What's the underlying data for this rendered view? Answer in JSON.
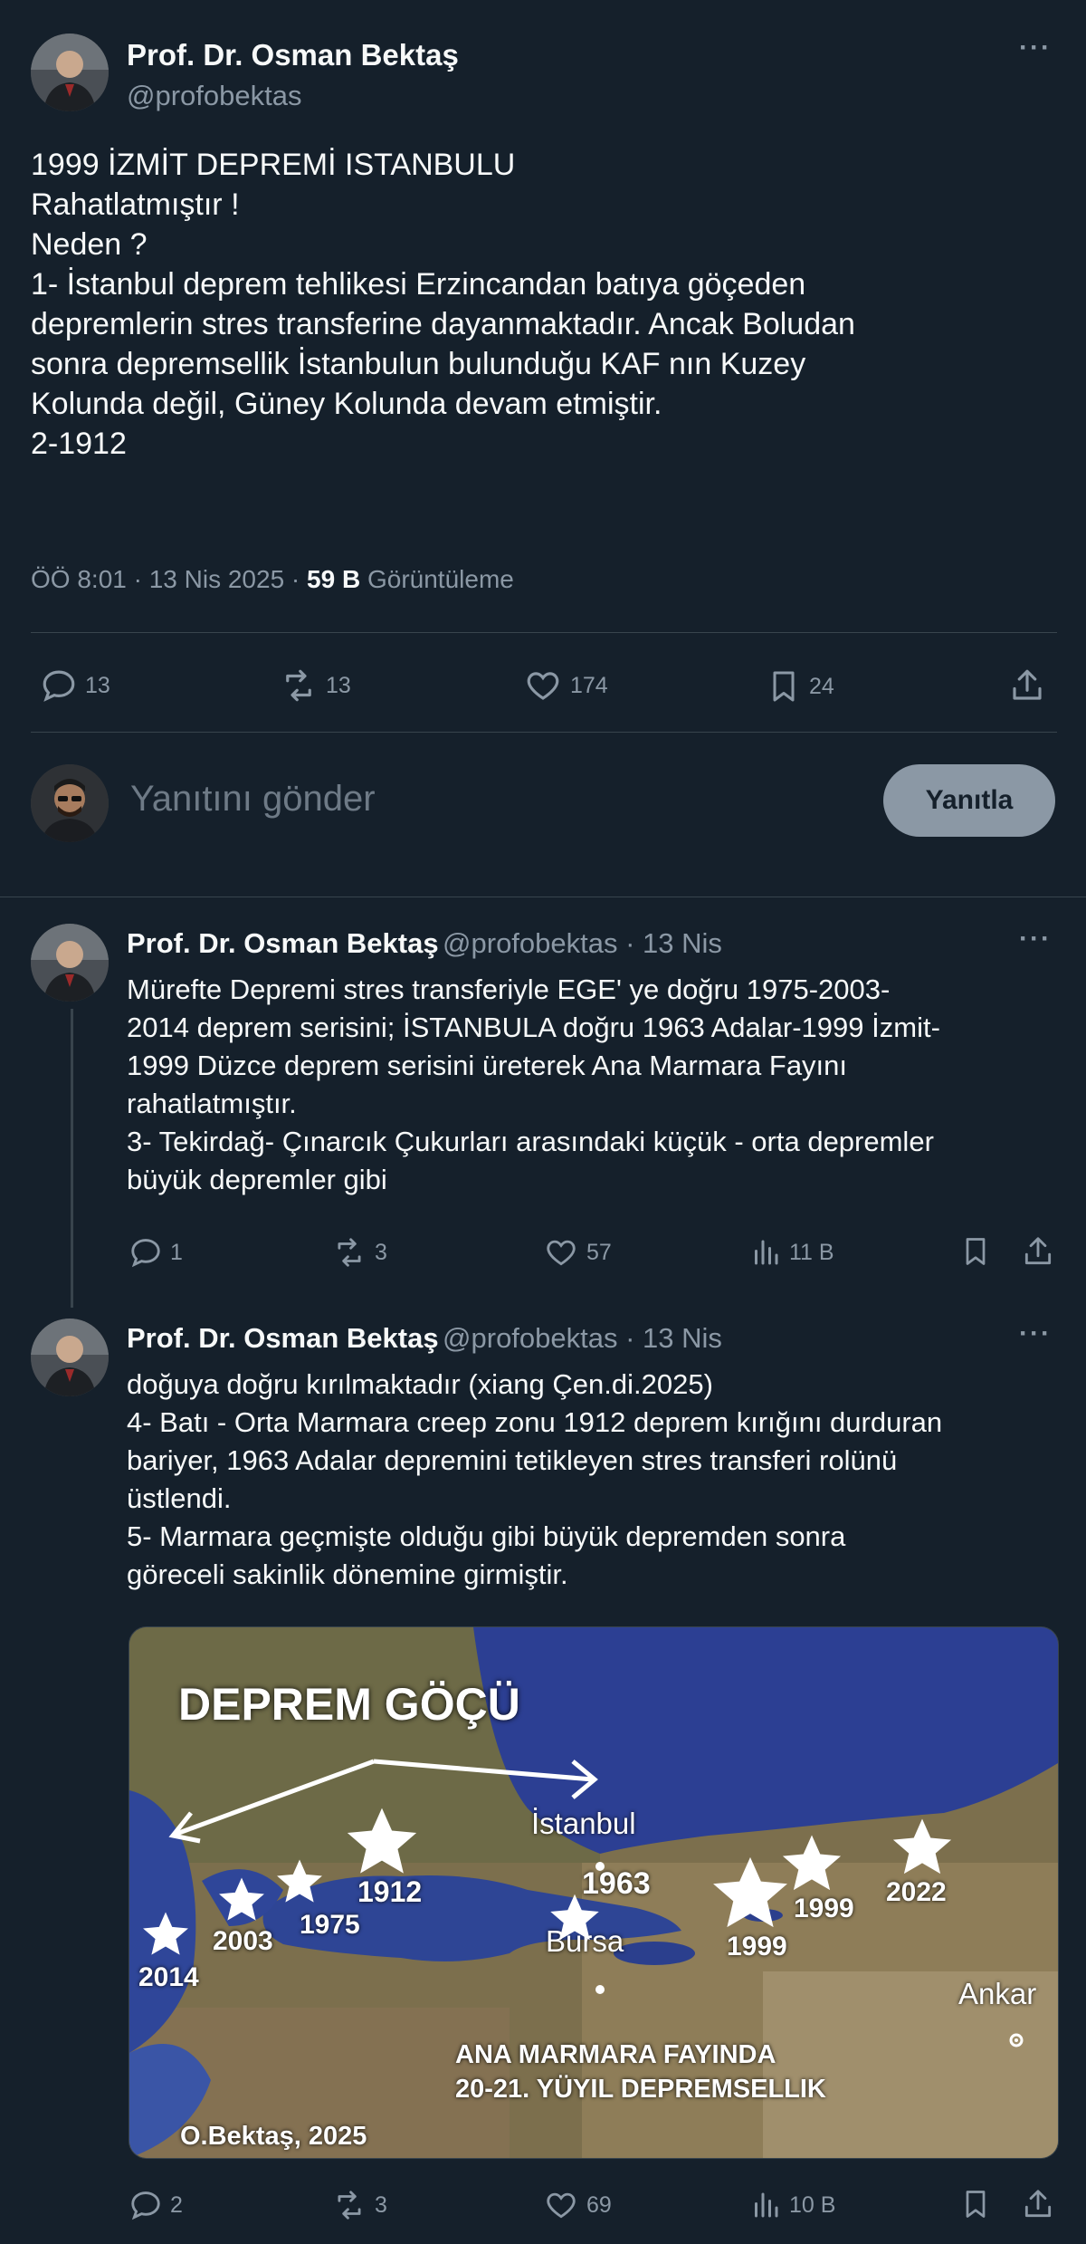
{
  "main_tweet": {
    "author_name": "Prof. Dr. Osman Bektaş",
    "author_handle": "@profobektas",
    "lines": [
      "1999 İZMİT DEPREMİ ISTANBULU",
      "Rahatlatmıştır !",
      "Neden ?",
      "1- İstanbul deprem tehlikesi Erzincandan batıya göçeden",
      "depremlerin stres transferine dayanmaktadır. Ancak Boludan",
      "sonra depremsellik İstanbulun bulunduğu  KAF nın Kuzey",
      "Kolunda değil, Güney Kolunda devam etmiştir.",
      "2-1912"
    ],
    "meta_time": "ÖÖ 8:01 · 13 Nis 2025 · ",
    "views_count": "59 B",
    "views_label": "Görüntüleme",
    "replies": "13",
    "retweets": "13",
    "likes": "174",
    "bookmarks": "24"
  },
  "reply_box": {
    "placeholder": "Yanıtını gönder",
    "button_label": "Yanıtla"
  },
  "reply1": {
    "author_name": "Prof. Dr. Osman Bektaş",
    "handle_time": "@profobektas · 13 Nis",
    "lines": [
      "Mürefte Depremi stres transferiyle EGE' ye doğru 1975-2003-",
      "2014 deprem serisini; İSTANBULA doğru 1963 Adalar-1999 İzmit-",
      "1999 Düzce deprem serisini üreterek Ana Marmara Fayını",
      "rahatlatmıştır.",
      "3- Tekirdağ- Çınarcık Çukurları arasındaki küçük - orta depremler",
      "büyük depremler gibi"
    ],
    "replies": "1",
    "retweets": "3",
    "likes": "57",
    "views": "11 B"
  },
  "reply2": {
    "author_name": "Prof. Dr. Osman Bektaş",
    "handle_time": "@profobektas · 13 Nis",
    "lines": [
      "doğuya doğru kırılmaktadır (xiang Çen.di.2025)",
      "4- Batı - Orta Marmara creep zonu 1912 deprem kırığını durduran",
      "bariyer, 1963 Adalar depremini tetikleyen stres transferi rolünü",
      "üstlendi.",
      "5- Marmara geçmişte olduğu gibi büyük depremden sonra",
      "göreceli sakinlik dönemine girmiştir."
    ],
    "replies": "2",
    "retweets": "3",
    "likes": "69",
    "views": "10 B",
    "image": {
      "title": "DEPREM GÖÇÜ",
      "city_istanbul": "İstanbul",
      "city_bursa": "Bursa",
      "city_ankara": "Ankar",
      "years": [
        "1912",
        "1963",
        "1975",
        "2003",
        "2014",
        "1999",
        "1999",
        "2022"
      ],
      "caption_line1": "ANA MARMARA FAYINDA",
      "caption_line2": "20-21. YÜYIL DEPREMSELLIK",
      "credit": "O.Bektaş, 2025"
    }
  },
  "colors": {
    "background": "#15202b",
    "text": "#f7f9f9",
    "muted": "#8b98a5",
    "divider": "#38444d",
    "button_bg": "#8b98a5"
  }
}
